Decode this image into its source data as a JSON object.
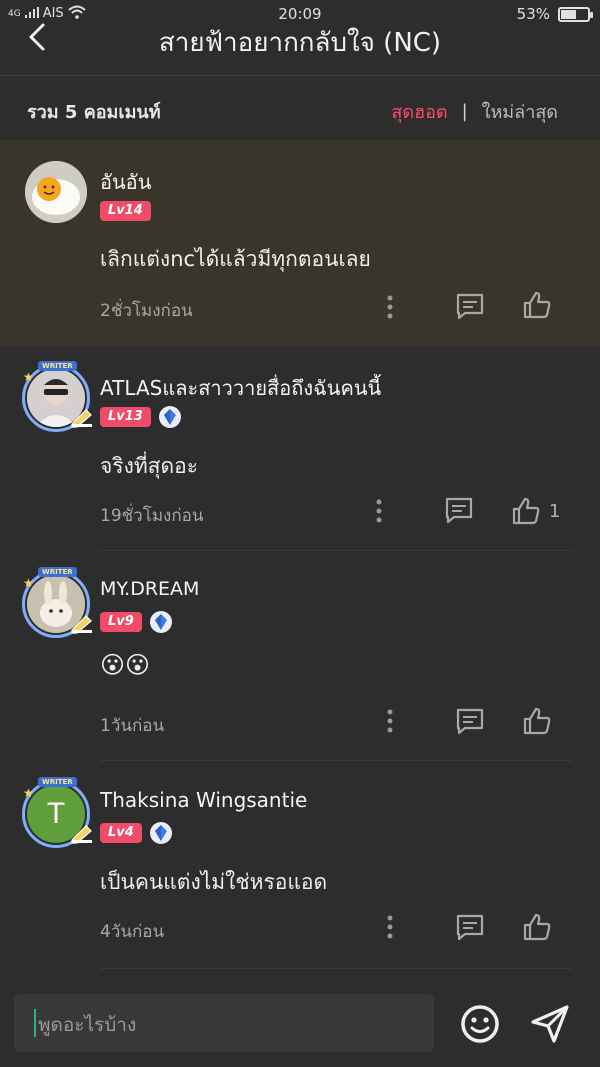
{
  "status_bar": {
    "network": "4G",
    "carrier": "AIS",
    "time": "20:09",
    "battery": "53%",
    "battery_level": 0.53
  },
  "header": {
    "title": "สายฟ้าอยากกลับใจ (NC)"
  },
  "summary": {
    "count_label": "รวม 5 คอมเมนท์",
    "sort_hot": "สุดฮอต",
    "sort_separator": "|",
    "sort_new": "ใหม่ล่าสุด"
  },
  "comments": [
    {
      "username": "อันอัน",
      "level": "Lv14",
      "text": "เลิกแต่งncได้แล้วมีทุกตอนเลย",
      "time": "2ชั่วโมงก่อน",
      "likes": ""
    },
    {
      "username": "ATLASและสาววายสื่อถึงฉันคนนี้",
      "level": "Lv13",
      "writer_tag": "WRITER",
      "text": "จริงที่สุดอะ",
      "time": "19ชั่วโมงก่อน",
      "likes": "1"
    },
    {
      "username": "MY.DREAM",
      "level": "Lv9",
      "writer_tag": "WRITER",
      "text": "😮😮",
      "time": "1วันก่อน",
      "likes": ""
    },
    {
      "username": "Thaksina Wingsantie",
      "level": "Lv4",
      "writer_tag": "WRITER",
      "avatar_letter": "T",
      "text": "เป็นคนแต่งไม่ใช่หรอแอด",
      "time": "4วันก่อน",
      "likes": ""
    }
  ],
  "input": {
    "placeholder": "พูดอะไรบ้าง"
  },
  "colors": {
    "background": "#2d2d2d",
    "highlight": "#39352b",
    "accent": "#ff4d6d",
    "level_badge": "#f04b69",
    "avatar_t": "#5f9e3a"
  },
  "icons": [
    "back-arrow-icon",
    "more-vertical-icon",
    "comment-icon",
    "like-icon",
    "crystal-icon",
    "emoji-icon",
    "send-icon",
    "wifi-icon",
    "signal-icon"
  ]
}
